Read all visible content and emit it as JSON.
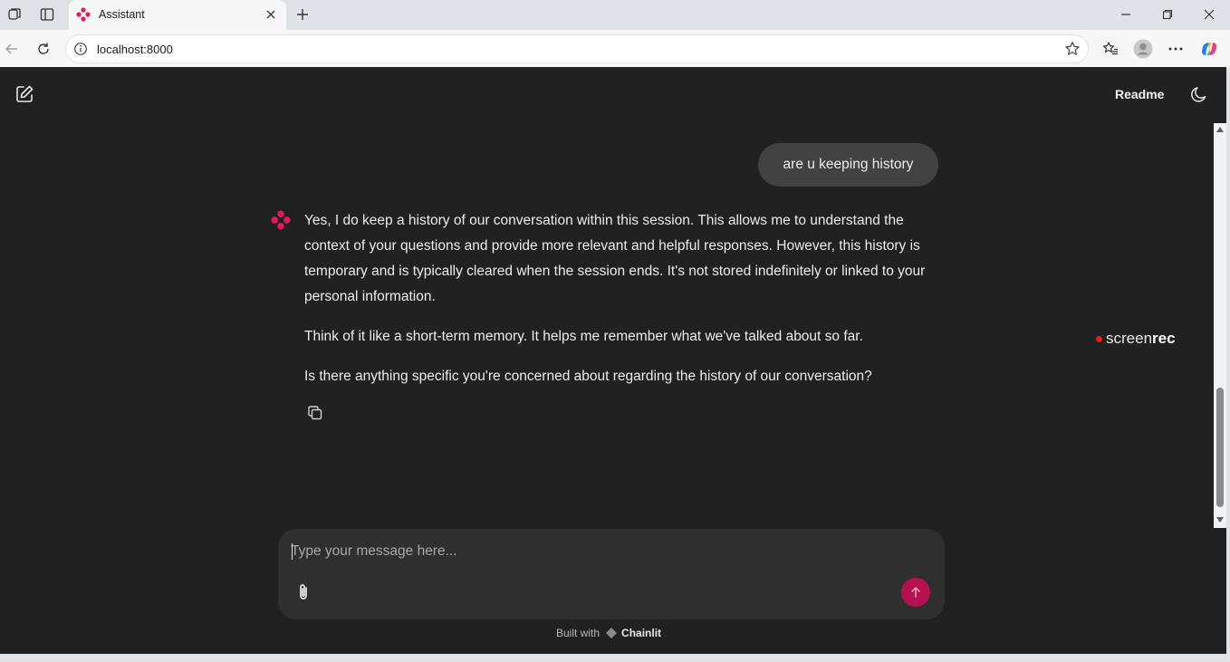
{
  "browser": {
    "tab_title": "Assistant",
    "url": "localhost:8000"
  },
  "header": {
    "readme_label": "Readme"
  },
  "chat": {
    "user_message": "are u keeping history",
    "assistant_paragraphs": [
      "Yes, I do keep a history of our conversation within this session. This allows me to understand the context of your questions and provide more relevant and helpful responses. However, this history is temporary and is typically cleared when the session ends. It's not stored indefinitely or linked to your personal information.",
      "Think of it like a short-term memory. It helps me remember what we've talked about so far.",
      "Is there anything specific you're concerned about regarding the history of our conversation?"
    ]
  },
  "composer": {
    "placeholder": "Type your message here..."
  },
  "footer": {
    "built_with": "Built with",
    "brand": "Chainlit"
  },
  "watermark": {
    "part1": "screen",
    "part2": "rec"
  },
  "colors": {
    "app_background": "#212121",
    "user_bubble": "#424242",
    "composer": "#2f2f2f",
    "send_button": "#b5104f",
    "brand_pink": "#e8175d"
  },
  "icons": [
    "tab-actions-icon",
    "vertical-tabs-icon",
    "close-icon",
    "plus-icon",
    "minimize-icon",
    "restore-icon",
    "back-icon",
    "reload-icon",
    "info-icon",
    "star-icon",
    "favorites-icon",
    "profile-icon",
    "more-icon",
    "copilot-icon",
    "new-chat-icon",
    "moon-icon",
    "copy-icon",
    "paperclip-icon",
    "arrow-up-icon"
  ]
}
